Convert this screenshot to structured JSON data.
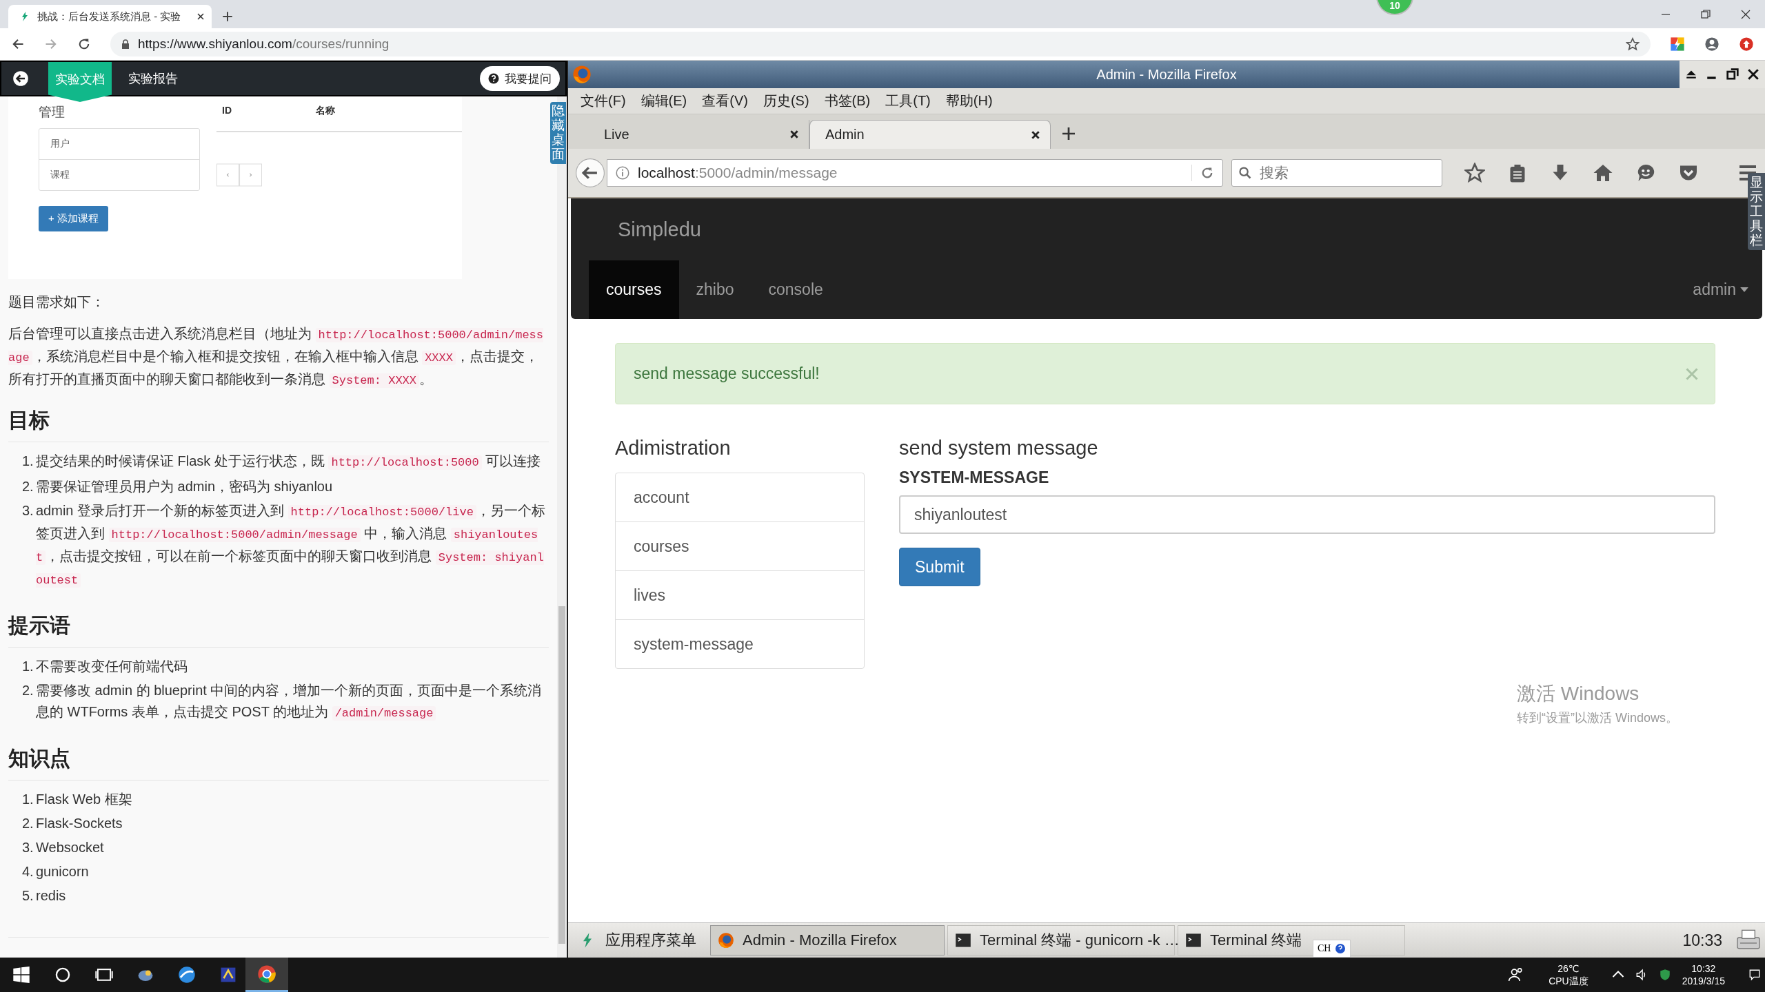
{
  "browser": {
    "tab_title": "挑战：后台发送系统消息 - 实验",
    "url_host": "https://www.shiyanlou.com",
    "url_path": "/courses/running",
    "badge": "10"
  },
  "doc_panel": {
    "tabs": [
      {
        "label": "实验文档",
        "selected": true
      },
      {
        "label": "实验报告",
        "selected": false
      }
    ],
    "ask_button": "我要提问",
    "side_tab": "隐藏桌面",
    "preview": {
      "sidebar_title": "管理",
      "sidebar_items": [
        "用户",
        "课程"
      ],
      "columns": [
        "ID",
        "名称"
      ],
      "add_button": "+ 添加课程"
    },
    "intro": "题目需求如下：",
    "paragraph": [
      {
        "kind": "text",
        "text": "后台管理可以直接点击进入系统消息栏目（地址为 "
      },
      {
        "kind": "code",
        "text": "http://localhost:5000/admin/message"
      },
      {
        "kind": "text",
        "text": "，系统消息栏目中是个输入框和提交按钮，在输入框中输入信息 "
      },
      {
        "kind": "code",
        "text": "XXXX"
      },
      {
        "kind": "text",
        "text": "，点击提交，所有打开的直播页面中的聊天窗口都能收到一条消息 "
      },
      {
        "kind": "code",
        "text": "System: XXXX"
      },
      {
        "kind": "text",
        "text": "。"
      }
    ],
    "sections": [
      {
        "heading": "目标",
        "items": [
          {
            "number": "1.",
            "parts": [
              {
                "kind": "text",
                "text": "提交结果的时候请保证 Flask 处于运行状态，既 "
              },
              {
                "kind": "code",
                "text": "http://localhost:5000"
              },
              {
                "kind": "text",
                "text": " 可以连接"
              }
            ]
          },
          {
            "number": "2.",
            "parts": [
              {
                "kind": "text",
                "text": "需要保证管理员用户为 admin，密码为 shiyanlou"
              }
            ]
          },
          {
            "number": "3.",
            "parts": [
              {
                "kind": "text",
                "text": "admin 登录后打开一个新的标签页进入到 "
              },
              {
                "kind": "code",
                "text": "http://localhost:5000/live"
              },
              {
                "kind": "text",
                "text": "，另一个标签页进入到 "
              },
              {
                "kind": "code",
                "text": "http://localhost:5000/admin/message"
              },
              {
                "kind": "text",
                "text": " 中，输入消息 "
              },
              {
                "kind": "code",
                "text": "shiyanloutest"
              },
              {
                "kind": "text",
                "text": "，点击提交按钮，可以在前一个标签页面中的聊天窗口收到消息 "
              },
              {
                "kind": "code",
                "text": "System: shiyanloutest"
              }
            ]
          }
        ]
      },
      {
        "heading": "提示语",
        "items": [
          {
            "number": "1.",
            "parts": [
              {
                "kind": "text",
                "text": "不需要改变任何前端代码"
              }
            ]
          },
          {
            "number": "2.",
            "parts": [
              {
                "kind": "text",
                "text": "需要修改 admin 的 blueprint 中间的内容，增加一个新的页面，页面中是一个系统消息的 WTForms 表单，点击提交 POST 的地址为 "
              },
              {
                "kind": "code",
                "text": "/admin/message"
              }
            ]
          }
        ]
      },
      {
        "heading": "知识点",
        "items": [
          {
            "number": "1.",
            "parts": [
              {
                "kind": "text",
                "text": "Flask Web 框架"
              }
            ]
          },
          {
            "number": "2.",
            "parts": [
              {
                "kind": "text",
                "text": "Flask-Sockets"
              }
            ]
          },
          {
            "number": "3.",
            "parts": [
              {
                "kind": "text",
                "text": "Websocket"
              }
            ]
          },
          {
            "number": "4.",
            "parts": [
              {
                "kind": "text",
                "text": "gunicorn"
              }
            ]
          },
          {
            "number": "5.",
            "parts": [
              {
                "kind": "text",
                "text": "redis"
              }
            ]
          }
        ]
      }
    ]
  },
  "firefox": {
    "title": "Admin - Mozilla Firefox",
    "menus": [
      "文件(F)",
      "编辑(E)",
      "查看(V)",
      "历史(S)",
      "书签(B)",
      "工具(T)",
      "帮助(H)"
    ],
    "tabs": [
      {
        "label": "Live",
        "selected": false
      },
      {
        "label": "Admin",
        "selected": true
      }
    ],
    "url_host": "localhost",
    "url_path": ":5000/admin/message",
    "search_placeholder": "搜索",
    "side_tab": "显示工具栏",
    "page": {
      "brand": "Simpledu",
      "nav": [
        {
          "label": "courses",
          "selected": true
        },
        {
          "label": "zhibo",
          "selected": false
        },
        {
          "label": "console",
          "selected": false
        }
      ],
      "user_menu": "admin",
      "alert": "send message successful!",
      "sidebar_heading": "Adimistration",
      "sidebar_items": [
        "account",
        "courses",
        "lives",
        "system-message"
      ],
      "form_heading": "send system message",
      "field_label": "SYSTEM-MESSAGE",
      "field_value": "shiyanloutest",
      "submit": "Submit"
    }
  },
  "activation_notice": {
    "title": "激活 Windows",
    "hint": "转到“设置”以激活 Windows。"
  },
  "xfce_panel": {
    "menu": "应用程序菜单",
    "tasks": [
      {
        "label": "Admin - Mozilla Firefox",
        "kind": "firefox",
        "selected": true
      },
      {
        "label": "Terminal 终端 - gunicorn -k …",
        "kind": "terminal",
        "selected": false
      },
      {
        "label": "Terminal 终端",
        "kind": "terminal",
        "selected": false
      }
    ],
    "ime": "CH",
    "clock": "10:33"
  },
  "taskbar": {
    "temperature": "26℃",
    "sensor": "CPU温度",
    "time": "10:32",
    "date": "2019/3/15"
  }
}
